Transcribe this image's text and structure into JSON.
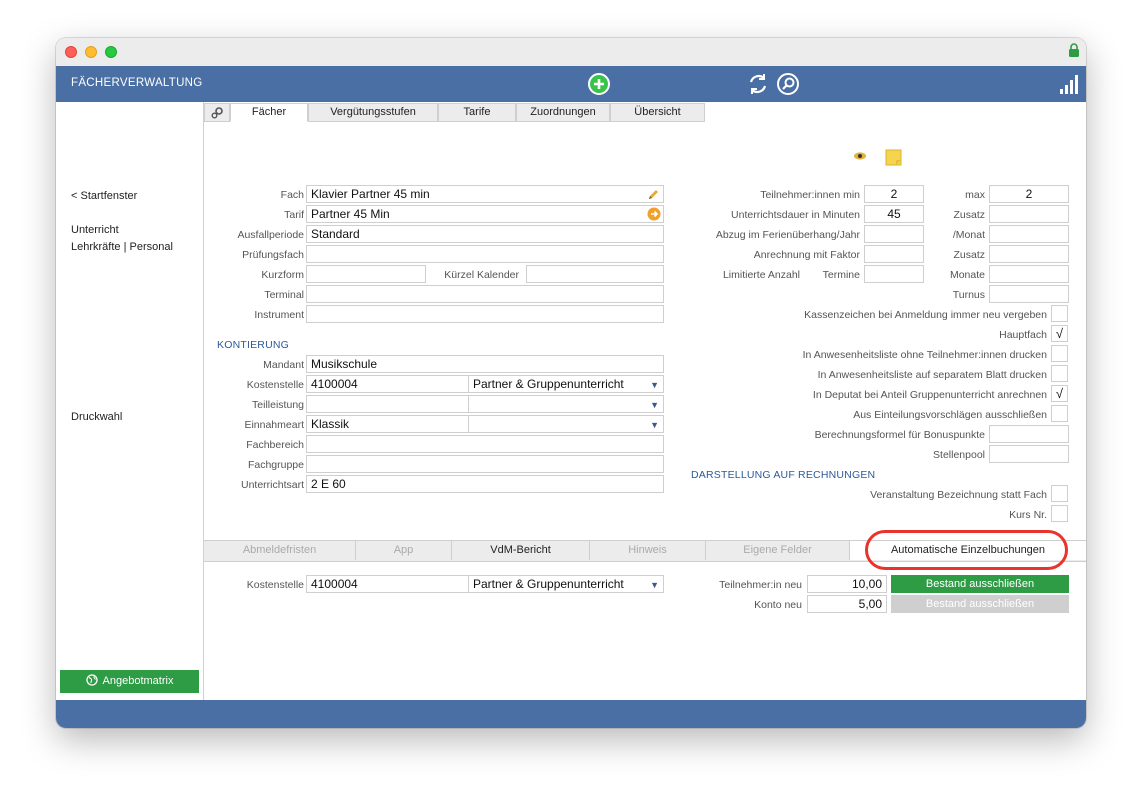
{
  "header": {
    "title": "FÄCHERVERWALTUNG"
  },
  "sidebar": {
    "back": "< Startfenster",
    "unterricht": "Unterricht",
    "lehrkraefte": "Lehrkräfte | Personal",
    "druckwahl": "Druckwahl",
    "angebot": "Angebotmatrix"
  },
  "tabs": [
    "Fächer",
    "Vergütungsstufen",
    "Tarife",
    "Zuordnungen",
    "Übersicht"
  ],
  "form": {
    "fach": {
      "label": "Fach",
      "value": "Klavier Partner 45 min"
    },
    "tarif": {
      "label": "Tarif",
      "value": "Partner 45 Min"
    },
    "ausfall": {
      "label": "Ausfallperiode",
      "value": "Standard"
    },
    "pruefung": {
      "label": "Prüfungsfach",
      "value": ""
    },
    "kurzform": {
      "label": "Kurzform",
      "value": ""
    },
    "kuerzel": {
      "label": "Kürzel Kalender",
      "value": ""
    },
    "terminal": {
      "label": "Terminal",
      "value": ""
    },
    "instrument": {
      "label": "Instrument",
      "value": ""
    }
  },
  "kontierung": {
    "title": "KONTIERUNG",
    "mandant": {
      "label": "Mandant",
      "value": "Musikschule"
    },
    "kostenstelle": {
      "label": "Kostenstelle",
      "value": "4100004",
      "value2": "Partner & Gruppenunterricht"
    },
    "teilleistung": {
      "label": "Teilleistung",
      "value": "",
      "value2": ""
    },
    "einnahmeart": {
      "label": "Einnahmeart",
      "value": "Klassik",
      "value2": ""
    },
    "fachbereich": {
      "label": "Fachbereich",
      "value": ""
    },
    "fachgruppe": {
      "label": "Fachgruppe",
      "value": ""
    },
    "unterrichtsart": {
      "label": "Unterrichtsart",
      "value": "2 E 60"
    }
  },
  "right": {
    "tn_min": {
      "label": "Teilnehmer:innen min",
      "value": "2"
    },
    "max": {
      "label": "max",
      "value": "2"
    },
    "dauer": {
      "label": "Unterrichtsdauer in Minuten",
      "value": "45"
    },
    "zusatz1": {
      "label": "Zusatz",
      "value": ""
    },
    "abzug": {
      "label": "Abzug im Ferienüberhang/Jahr",
      "value": ""
    },
    "monat": {
      "label": "/Monat",
      "value": ""
    },
    "anrechnung": {
      "label": "Anrechnung mit Faktor",
      "value": ""
    },
    "zusatz2": {
      "label": "Zusatz",
      "value": ""
    },
    "limitiert": {
      "label": "Limitierte Anzahl",
      "value": ""
    },
    "termine": {
      "label": "Termine",
      "value": ""
    },
    "monate": {
      "label": "Monate",
      "value": ""
    },
    "turnus": {
      "label": "Turnus",
      "value": ""
    },
    "kassen": {
      "label": "Kassenzeichen bei Anmeldung immer neu vergeben",
      "checked": ""
    },
    "hauptfach": {
      "label": "Hauptfach",
      "checked": "√"
    },
    "anw1": {
      "label": "In Anwesenheitsliste ohne Teilnehmer:innen drucken",
      "checked": ""
    },
    "anw2": {
      "label": "In Anwesenheitsliste auf separatem Blatt drucken",
      "checked": ""
    },
    "deputat": {
      "label": "In Deputat bei Anteil Gruppenunterricht anrechnen",
      "checked": "√"
    },
    "einteilung": {
      "label": "Aus Einteilungsvorschlägen ausschließen",
      "checked": ""
    },
    "bonus": {
      "label": "Berechnungsformel für Bonuspunkte",
      "value": ""
    },
    "stellenpool": {
      "label": "Stellenpool",
      "value": ""
    }
  },
  "darstellung": {
    "title": "DARSTELLUNG AUF RECHNUNGEN",
    "veranstaltung": {
      "label": "Veranstaltung Bezeichnung statt Fach",
      "checked": ""
    },
    "kurs": {
      "label": "Kurs Nr.",
      "checked": ""
    }
  },
  "bottom_tabs": [
    "Abmeldefristen",
    "App",
    "VdM-Bericht",
    "Hinweis",
    "Eigene Felder",
    "Automatische Einzelbuchungen"
  ],
  "bottom": {
    "kostenstelle": {
      "label": "Kostenstelle",
      "value": "4100004",
      "value2": "Partner & Gruppenunterricht"
    },
    "tn_neu": {
      "label": "Teilnehmer:in neu",
      "value": "10,00",
      "button": "Bestand ausschließen"
    },
    "konto_neu": {
      "label": "Konto neu",
      "value": "5,00",
      "button": "Bestand ausschließen"
    }
  },
  "colors": {
    "header": "#4a6fa5",
    "accent_green": "#2e9c45",
    "highlight": "#e8342a"
  }
}
